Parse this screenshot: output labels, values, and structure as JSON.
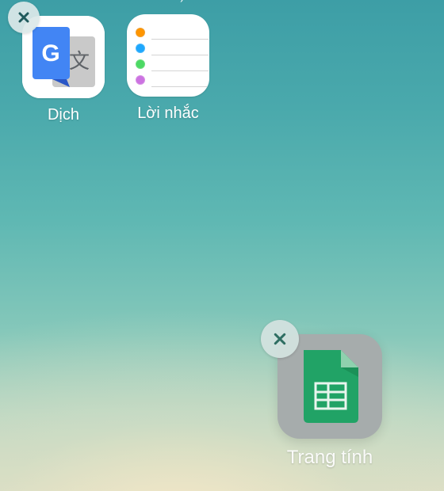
{
  "status_bar": {
    "text": ") · · · · ·   · · · · ·   · · · · · · · · · ·   ·"
  },
  "home_screen": {
    "apps": [
      {
        "label": "Dịch",
        "icon": "google-translate-icon",
        "delete_badge": "close-icon"
      },
      {
        "label": "Lời nhắc",
        "icon": "reminders-icon",
        "delete_badge": "close-icon"
      },
      {
        "label": "Trang tính",
        "icon": "google-sheets-icon",
        "delete_badge": "close-icon",
        "state": "dragging"
      }
    ]
  },
  "colors": {
    "translate_blue": "#4285f4",
    "translate_gray": "#c4c4c4",
    "reminder_orange": "#ff9500",
    "reminder_blue": "#1ea7fd",
    "reminder_green": "#4cd964",
    "reminder_purple": "#cc73e1",
    "sheets_green": "#21a366",
    "badge_x": "#1f5a5c"
  }
}
